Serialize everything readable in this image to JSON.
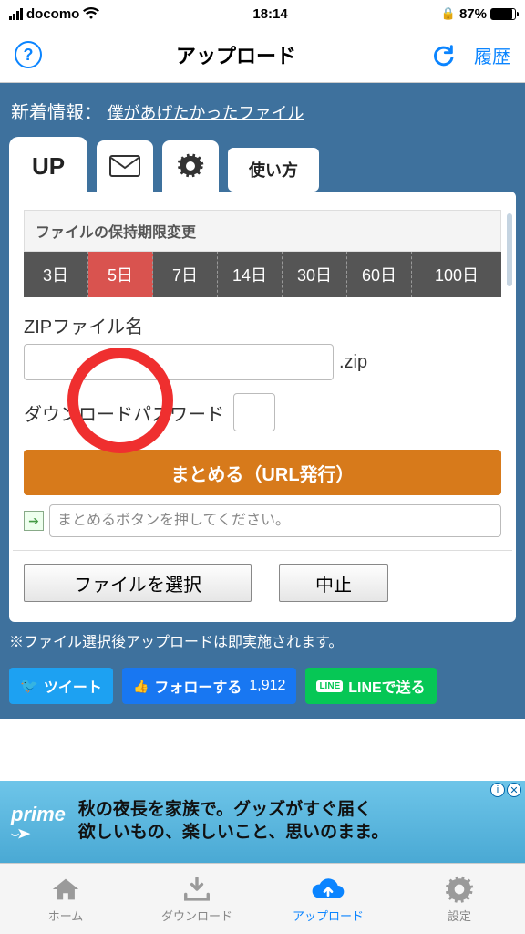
{
  "status_bar": {
    "carrier": "docomo",
    "time": "18:14",
    "battery_pct": "87%"
  },
  "nav": {
    "title": "アップロード",
    "history": "履歴"
  },
  "news": {
    "label": "新着情報：",
    "link": "僕があげたかったファイル"
  },
  "tabs": {
    "up": "UP",
    "guide": "使い方"
  },
  "content": {
    "retention_label": "ファイルの保持期限変更",
    "retention_options": [
      "3日",
      "5日",
      "7日",
      "14日",
      "30日",
      "60日",
      "100日"
    ],
    "retention_selected": "5日",
    "zip_label": "ZIPファイル名",
    "zip_ext": ".zip",
    "pw_label": "ダウンロードパスワード",
    "primary_btn": "まとめる（URL発行）",
    "url_placeholder": "まとめるボタンを押してください。",
    "choose_file": "ファイルを選択",
    "cancel": "中止",
    "note": "※ファイル選択後アップロードは即実施されます。"
  },
  "social": {
    "tweet": "ツイート",
    "follow": "フォローする",
    "follow_count": "1,912",
    "line": "LINEで送る",
    "line_badge": "LINE"
  },
  "ad": {
    "logo": "prime",
    "line1": "秋の夜長を家族で。グッズがすぐ届く",
    "line2": "欲しいもの、楽しいこと、思いのまま。"
  },
  "bottom_tabs": {
    "home": "ホーム",
    "download": "ダウンロード",
    "upload": "アップロード",
    "settings": "設定"
  }
}
